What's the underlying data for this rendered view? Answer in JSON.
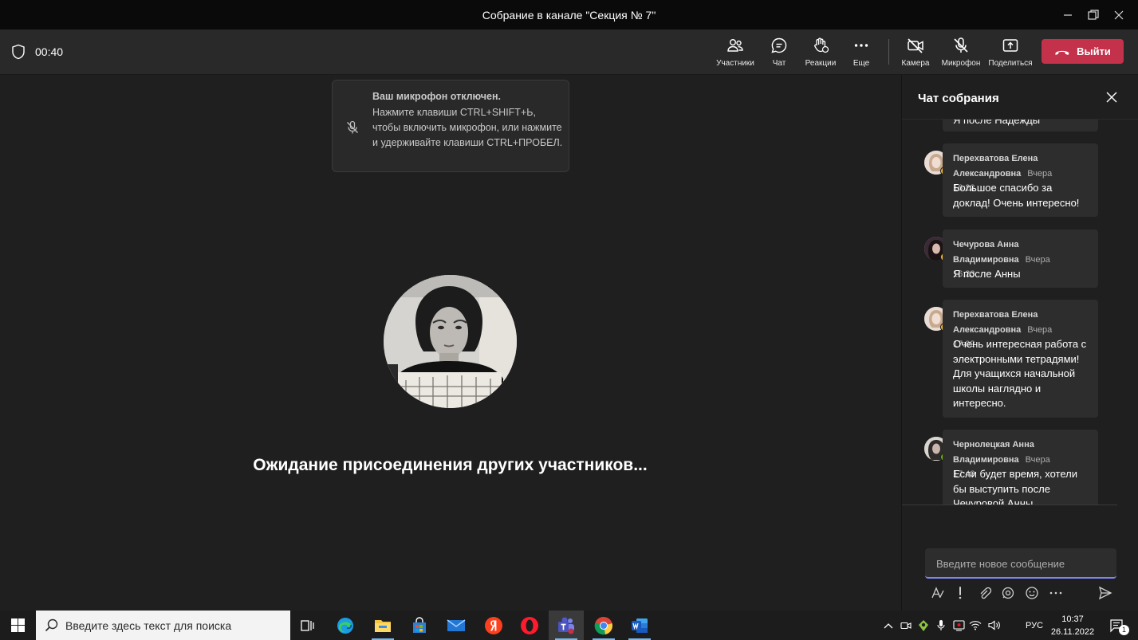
{
  "window": {
    "title": "Собрание в канале \"Секция № 7\""
  },
  "toolbar": {
    "timer": "00:40",
    "participants": "Участники",
    "chat": "Чат",
    "reactions": "Реакции",
    "more": "Еще",
    "camera": "Камера",
    "microphone": "Микрофон",
    "share": "Поделиться",
    "leave": "Выйти"
  },
  "toast": {
    "title": "Ваш микрофон отключен.",
    "body": "Нажмите клавиши CTRL+SHIFT+Ь, чтобы включить микрофон, или нажмите и удерживайте клавиши CTRL+ПРОБЕЛ."
  },
  "stage": {
    "waiting": "Ожидание присоединения других участников..."
  },
  "chat": {
    "header": "Чат собрания",
    "partial_prev": "Я после Надежды",
    "messages": [
      {
        "name_line1": "Перехватова Елена",
        "name_line2": "Александровна",
        "time": "Вчера 16:22",
        "text": "Большое спасибо за доклад! Очень интересно!",
        "status_color": "#f8b92a"
      },
      {
        "name_line1": "Чечурова Анна",
        "name_line2": "Владимировна",
        "time": "Вчера 16:23",
        "text": "Я после Анны",
        "status_color": "#f8b92a"
      },
      {
        "name_line1": "Перехватова Елена",
        "name_line2": "Александровна",
        "time": "Вчера 17:02",
        "text": "Очень интересная работа с электронными тетрадями! Для учащихся начальной школы наглядно и интересно.",
        "status_color": "#f8b92a"
      },
      {
        "name_line1": "Чернолецкая Анна",
        "name_line2": "Владимировна",
        "time": "Вчера 17:43",
        "text": "Если будет время, хотели бы выступить после Чечуровой Анны",
        "status_color": "#6bb700"
      }
    ],
    "input_placeholder": "Введите новое сообщение"
  },
  "taskbar": {
    "search_placeholder": "Введите здесь текст для поиска",
    "language": "РУС",
    "time": "10:37",
    "date": "26.11.2022",
    "notification_count": "1"
  },
  "colors": {
    "leave": "#c4314b",
    "accent": "#7f85f5",
    "away": "#f8b92a",
    "available": "#6bb700"
  }
}
